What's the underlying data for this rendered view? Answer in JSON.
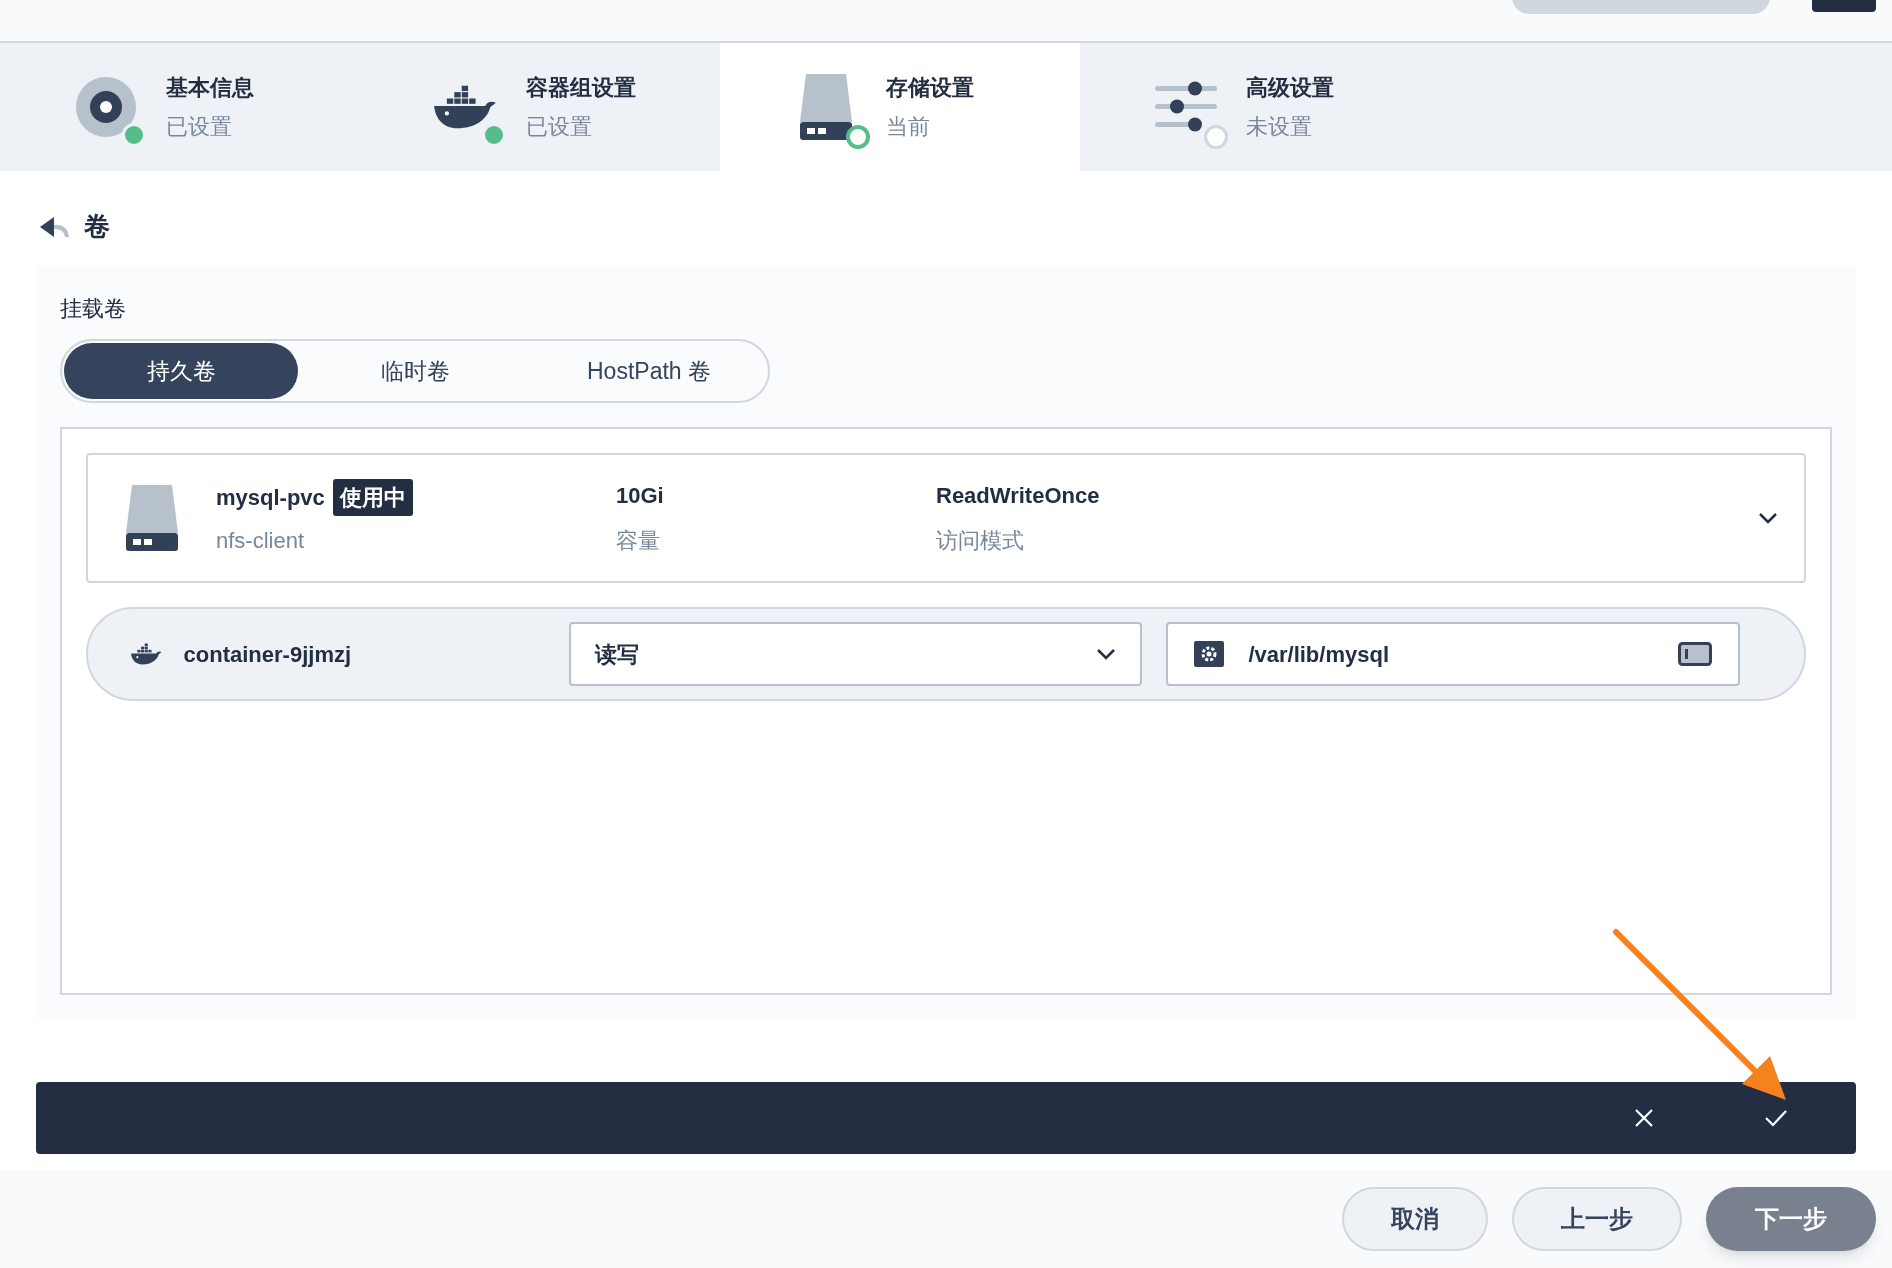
{
  "steps": [
    {
      "title": "基本信息",
      "status_text": "已设置",
      "completed": true,
      "selected": false,
      "kind": "disc"
    },
    {
      "title": "容器组设置",
      "status_text": "已设置",
      "completed": true,
      "selected": false,
      "kind": "whale"
    },
    {
      "title": "存储设置",
      "status_text": "当前",
      "completed": false,
      "selected": true,
      "kind": "drive"
    },
    {
      "title": "高级设置",
      "status_text": "未设置",
      "completed": false,
      "selected": false,
      "kind": "sliders"
    }
  ],
  "section_title": "卷",
  "mount_label": "挂载卷",
  "tabs": [
    {
      "label": "持久卷",
      "selected": true
    },
    {
      "label": "临时卷",
      "selected": false
    },
    {
      "label": "HostPath 卷",
      "selected": false
    }
  ],
  "volume": {
    "name": "mysql-pvc",
    "badge": "使用中",
    "storage_class": "nfs-client",
    "capacity": "10Gi",
    "capacity_label": "容量",
    "access_mode": "ReadWriteOnce",
    "access_mode_label": "访问模式"
  },
  "mount": {
    "container": "container-9jjmzj",
    "mode": "读写",
    "path": "/var/lib/mysql"
  },
  "footer_buttons": [
    {
      "label": "取消",
      "kind": "secondary"
    },
    {
      "label": "上一步",
      "kind": "secondary"
    },
    {
      "label": "下一步",
      "kind": "primary"
    }
  ]
}
